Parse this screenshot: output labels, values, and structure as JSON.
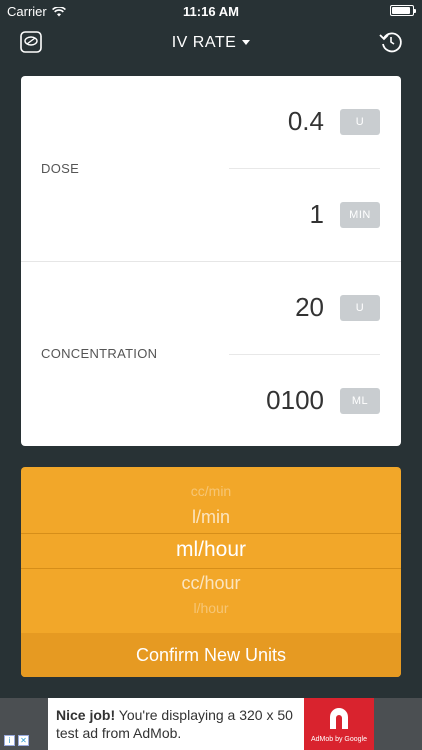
{
  "status_bar": {
    "carrier": "Carrier",
    "time": "11:16 AM"
  },
  "nav": {
    "title": "IV RATE"
  },
  "dose": {
    "label": "DOSE",
    "amount_value": "0.4",
    "amount_unit": "U",
    "time_value": "1",
    "time_unit": "MIN"
  },
  "concentration": {
    "label": "CONCENTRATION",
    "amount_value": "20",
    "amount_unit": "U",
    "volume_value": "0100",
    "volume_unit": "ML"
  },
  "picker": {
    "options": [
      "cc/min",
      "l/min",
      "ml/hour",
      "cc/hour",
      "l/hour"
    ],
    "selected": "ml/hour",
    "confirm_label": "Confirm New Units"
  },
  "ad": {
    "headline": "Nice job!",
    "body": "You're displaying a 320 x 50 test ad from AdMob.",
    "brand": "AdMob by Google"
  },
  "colors": {
    "background": "#283235",
    "accent": "#f2a729",
    "card": "#ffffff",
    "unit_button": "#c9cdd0"
  }
}
